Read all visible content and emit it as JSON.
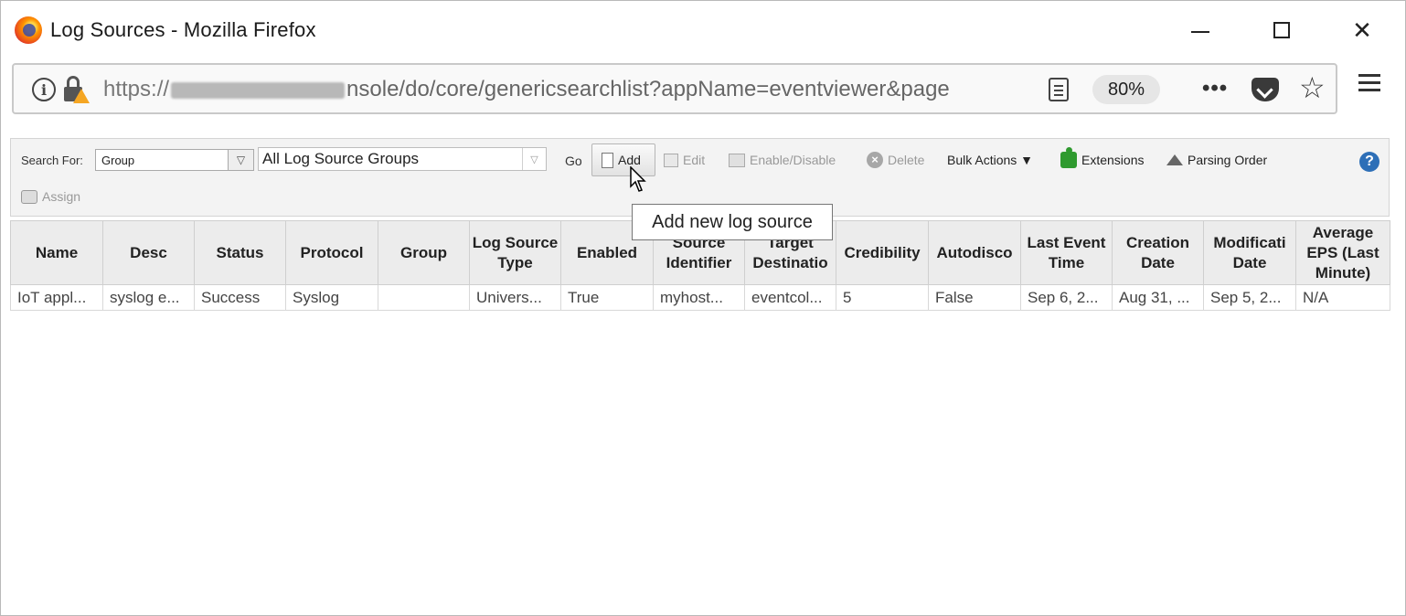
{
  "window": {
    "title": "Log Sources - Mozilla Firefox",
    "controls": {
      "minimize": "minimize",
      "maximize": "maximize",
      "close": "✕"
    }
  },
  "navbar": {
    "url_prefix": "https://",
    "url_suffix": "nsole/do/core/genericsearchlist?appName=eventviewer&page",
    "zoom": "80%",
    "more": "•••"
  },
  "toolbar": {
    "search_for_label": "Search For:",
    "search_for_value": "Group",
    "group_value": "All Log Source Groups",
    "go_label": "Go",
    "add_label": "Add",
    "edit_label": "Edit",
    "enable_disable_label": "Enable/Disable",
    "delete_label": "Delete",
    "bulk_actions_label": "Bulk Actions ▼",
    "extensions_label": "Extensions",
    "parsing_order_label": "Parsing Order",
    "assign_label": "Assign",
    "help": "?"
  },
  "tooltip": {
    "text": "Add new log source"
  },
  "table": {
    "headers": [
      "Name",
      "Desc",
      "Status",
      "Protocol",
      "Group",
      "Log Source Type",
      "Enabled",
      "Source Identifier",
      "Target Destinatio",
      "Credibility",
      "Autodisco",
      "Last Event Time",
      "Creation Date",
      "Modificati Date",
      "Average EPS (Last Minute)"
    ],
    "rows": [
      [
        "IoT appl...",
        "syslog e...",
        "Success",
        "Syslog",
        "",
        "Univers...",
        "True",
        "myhost...",
        "eventcol...",
        "5",
        "False",
        "Sep 6, 2...",
        "Aug 31, ...",
        "Sep 5, 2...",
        "N/A"
      ]
    ]
  }
}
